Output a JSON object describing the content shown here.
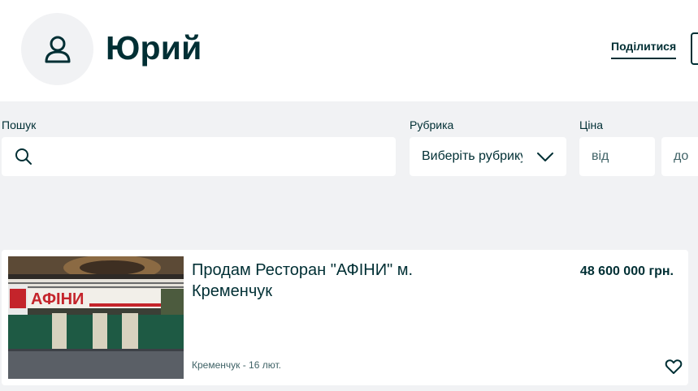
{
  "profile": {
    "name": "Юрий",
    "avatar_icon": "user-icon",
    "share_label": "Поділитися"
  },
  "filters": {
    "search": {
      "label": "Пошук",
      "value": "",
      "icon": "search-icon"
    },
    "category": {
      "label": "Рубрика",
      "value": "Виберіть рубрику",
      "icon": "chevron-down-icon"
    },
    "price": {
      "label": "Ціна",
      "from_placeholder": "від",
      "to_placeholder": "до"
    }
  },
  "listings": [
    {
      "title": "Продам Ресторан \"АФІНИ\" м. Кременчук",
      "price": "48 600 000 грн.",
      "location_date": "Кременчук - 16 лют.",
      "image_sign_text": "АФІНИ",
      "favorite_icon": "heart-icon"
    }
  ],
  "colors": {
    "primary_text": "#002f34",
    "page_background": "#f1f2f4",
    "card_background": "#ffffff",
    "muted_text": "#406367"
  }
}
